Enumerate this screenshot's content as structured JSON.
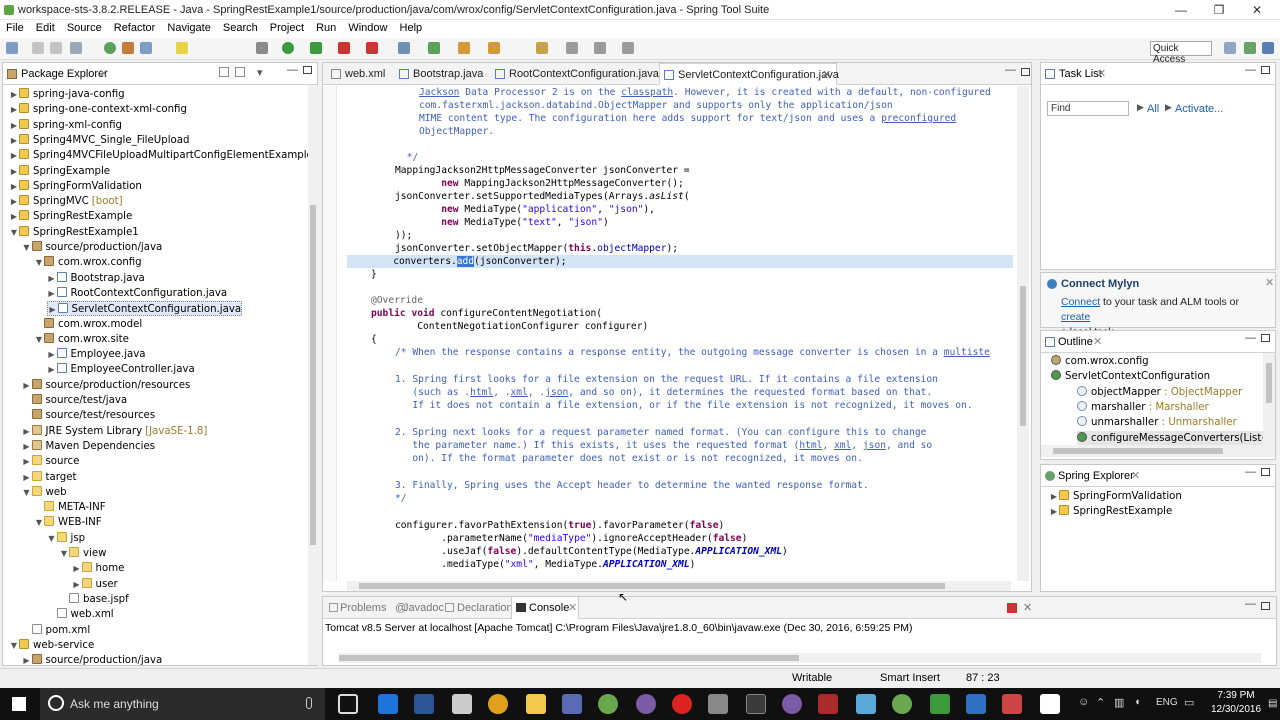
{
  "window": {
    "title": "workspace-sts-3.8.2.RELEASE - Java - SpringRestExample1/source/production/java/com/wrox/config/ServletContextConfiguration.java - Spring Tool Suite",
    "controls": {
      "minimize": "—",
      "maximize": "❐",
      "close": "✕"
    }
  },
  "menus": [
    "File",
    "Edit",
    "Source",
    "Refactor",
    "Navigate",
    "Search",
    "Project",
    "Run",
    "Window",
    "Help"
  ],
  "toolbar": {
    "quick_access": "Quick Access"
  },
  "package_explorer": {
    "title": "Package Explorer",
    "items": [
      {
        "label": "spring-java-config",
        "deco": "",
        "depth": 0,
        "icon": "proj",
        "open": false
      },
      {
        "label": "spring-one-context-xml-config",
        "deco": "",
        "depth": 0,
        "icon": "proj",
        "open": false
      },
      {
        "label": "spring-xml-config",
        "deco": "",
        "depth": 0,
        "icon": "proj",
        "open": false
      },
      {
        "label": "Spring4MVC_Single_FileUpload",
        "deco": "",
        "depth": 0,
        "icon": "proj",
        "open": false
      },
      {
        "label": "Spring4MVCFileUploadMultipartConfigElementExample",
        "deco": "",
        "depth": 0,
        "icon": "proj",
        "open": false
      },
      {
        "label": "SpringExample",
        "deco": "",
        "depth": 0,
        "icon": "proj",
        "open": false
      },
      {
        "label": "SpringFormValidation",
        "deco": "",
        "depth": 0,
        "icon": "proj",
        "open": false
      },
      {
        "label": "SpringMVC",
        "deco": "[boot]",
        "depth": 0,
        "icon": "proj",
        "open": false
      },
      {
        "label": "SpringRestExample",
        "deco": "",
        "depth": 0,
        "icon": "proj",
        "open": false
      },
      {
        "label": "SpringRestExample1",
        "deco": "",
        "depth": 0,
        "icon": "proj",
        "open": true
      },
      {
        "label": "source/production/java",
        "deco": "",
        "depth": 1,
        "icon": "pkg",
        "open": true
      },
      {
        "label": "com.wrox.config",
        "deco": "",
        "depth": 2,
        "icon": "pkg",
        "open": true
      },
      {
        "label": "Bootstrap.java",
        "deco": "",
        "depth": 3,
        "icon": "java",
        "open": false
      },
      {
        "label": "RootContextConfiguration.java",
        "deco": "",
        "depth": 3,
        "icon": "java",
        "open": false
      },
      {
        "label": "ServletContextConfiguration.java",
        "deco": "",
        "depth": 3,
        "icon": "java",
        "open": false,
        "selected": true
      },
      {
        "label": "com.wrox.model",
        "deco": "",
        "depth": 2,
        "icon": "pkg",
        "open": null
      },
      {
        "label": "com.wrox.site",
        "deco": "",
        "depth": 2,
        "icon": "pkg",
        "open": true
      },
      {
        "label": "Employee.java",
        "deco": "",
        "depth": 3,
        "icon": "java",
        "open": false
      },
      {
        "label": "EmployeeController.java",
        "deco": "",
        "depth": 3,
        "icon": "java",
        "open": false
      },
      {
        "label": "source/production/resources",
        "deco": "",
        "depth": 1,
        "icon": "pkg",
        "open": false
      },
      {
        "label": "source/test/java",
        "deco": "",
        "depth": 1,
        "icon": "pkg",
        "open": null
      },
      {
        "label": "source/test/resources",
        "deco": "",
        "depth": 1,
        "icon": "pkg",
        "open": null
      },
      {
        "label": "JRE System Library",
        "deco": "[JavaSE-1.8]",
        "depth": 1,
        "icon": "lib",
        "open": false
      },
      {
        "label": "Maven Dependencies",
        "deco": "",
        "depth": 1,
        "icon": "lib",
        "open": false
      },
      {
        "label": "source",
        "deco": "",
        "depth": 1,
        "icon": "folder",
        "open": false
      },
      {
        "label": "target",
        "deco": "",
        "depth": 1,
        "icon": "folder",
        "open": false
      },
      {
        "label": "web",
        "deco": "",
        "depth": 1,
        "icon": "folder",
        "open": true
      },
      {
        "label": "META-INF",
        "deco": "",
        "depth": 2,
        "icon": "folder",
        "open": null
      },
      {
        "label": "WEB-INF",
        "deco": "",
        "depth": 2,
        "icon": "folder",
        "open": true
      },
      {
        "label": "jsp",
        "deco": "",
        "depth": 3,
        "icon": "folder",
        "open": true
      },
      {
        "label": "view",
        "deco": "",
        "depth": 4,
        "icon": "folder",
        "open": true
      },
      {
        "label": "home",
        "deco": "",
        "depth": 5,
        "icon": "folder",
        "open": false
      },
      {
        "label": "user",
        "deco": "",
        "depth": 5,
        "icon": "folder",
        "open": false
      },
      {
        "label": "base.jspf",
        "deco": "",
        "depth": 4,
        "icon": "xml",
        "open": null
      },
      {
        "label": "web.xml",
        "deco": "",
        "depth": 3,
        "icon": "xml",
        "open": null
      },
      {
        "label": "pom.xml",
        "deco": "",
        "depth": 1,
        "icon": "xml",
        "open": null
      },
      {
        "label": "web-service",
        "deco": "",
        "depth": 0,
        "icon": "proj",
        "open": true
      },
      {
        "label": "source/production/java",
        "deco": "",
        "depth": 1,
        "icon": "pkg",
        "open": false
      }
    ]
  },
  "editor": {
    "tabs": [
      "web.xml",
      "Bootstrap.java",
      "RootContextConfiguration.java",
      "ServletContextConfiguration.java"
    ],
    "active_tab": "ServletContextConfiguration.java"
  },
  "task_list": {
    "title": "Task List",
    "find_placeholder": "Find",
    "all": "All",
    "activate": "Activate..."
  },
  "mylyn": {
    "title": "Connect Mylyn",
    "connect": "Connect",
    "text1": " to your task and ALM tools or ",
    "create": "create",
    "text2": "a local task."
  },
  "outline": {
    "title": "Outline",
    "items": [
      {
        "label": "com.wrox.config",
        "type": "",
        "depth": 0
      },
      {
        "label": "ServletContextConfiguration",
        "type": "",
        "depth": 0
      },
      {
        "label": "objectMapper",
        "type": " : ObjectMapper",
        "depth": 1
      },
      {
        "label": "marshaller",
        "type": " : Marshaller",
        "depth": 1
      },
      {
        "label": "unmarshaller",
        "type": " : Unmarshaller",
        "depth": 1
      },
      {
        "label": "configureMessageConverters(List<Htt",
        "type": "",
        "depth": 1
      }
    ]
  },
  "spring_explorer": {
    "title": "Spring Explorer",
    "items": [
      "SpringFormValidation",
      "SpringRestExample"
    ]
  },
  "console": {
    "tabs": [
      "Problems",
      "Javadoc",
      "Declaration",
      "Console"
    ],
    "active": "Console",
    "text": "Tomcat v8.5 Server at localhost [Apache Tomcat] C:\\Program Files\\Java\\jre1.8.0_60\\bin\\javaw.exe (Dec 30, 2016, 6:59:25 PM)"
  },
  "statusbar": {
    "writable": "Writable",
    "insert": "Smart Insert",
    "position": "87 : 23"
  },
  "taskbar": {
    "search": "Ask me anything",
    "time": "7:39 PM",
    "date": "12/30/2016",
    "lang": "ENG"
  }
}
